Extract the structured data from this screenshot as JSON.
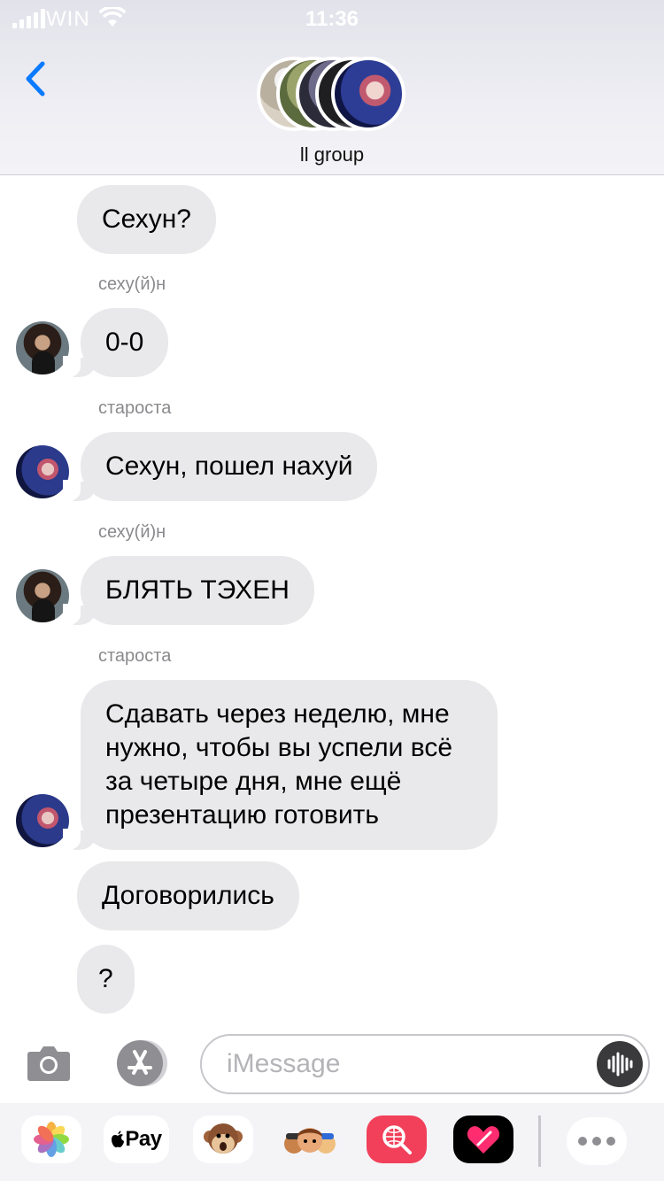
{
  "status_bar": {
    "carrier": "WIN",
    "time": "11:36"
  },
  "header": {
    "group_name": "ll group"
  },
  "messages": [
    {
      "text": "Сехун?"
    },
    {
      "sender": "сеху(й)н",
      "text": "0-0"
    },
    {
      "sender": "староста",
      "text": "Сехун, пошел нахуй"
    },
    {
      "sender": "сеху(й)н",
      "text": "БЛЯТЬ ТЭХЕН"
    },
    {
      "sender": "староста",
      "text": "Сдавать через неделю, мне нужно, чтобы вы успели всё за четыре дня, мне ещё презентацию готовить"
    },
    {
      "text": "Договорились"
    },
    {
      "text": "?"
    }
  ],
  "input": {
    "placeholder": "iMessage"
  },
  "app_drawer": {
    "apple_pay_label": "Pay"
  },
  "colors": {
    "bubble_gray": "#e9e9eb",
    "accent_blue": "#0a7aff",
    "sender_gray": "#8a8a8e"
  },
  "icons": [
    "back-chevron-icon",
    "camera-icon",
    "app-store-icon",
    "voice-waveform-icon",
    "photos-icon",
    "apple-pay-icon",
    "animoji-icon",
    "memoji-icon",
    "web-search-icon",
    "digital-touch-icon",
    "more-icon"
  ]
}
